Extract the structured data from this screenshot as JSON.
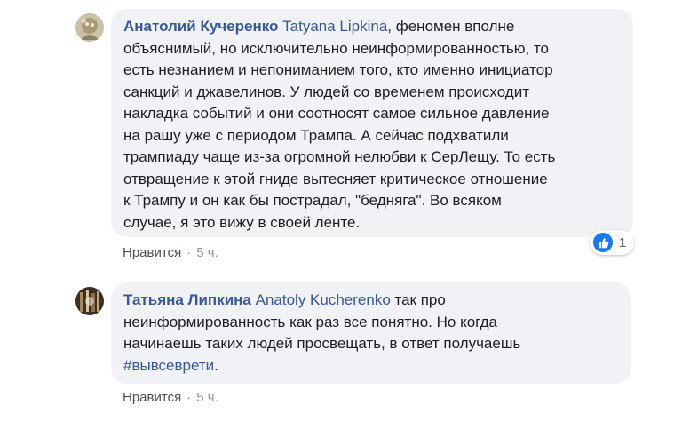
{
  "comments": [
    {
      "author": "Анатолий Кучеренко",
      "mention": "Tatyana Lipkina",
      "lines": [
        ", феномен вполне",
        "объяснимый, но исключительно неинформированностью, то",
        "есть незнанием и непониманием того, кто именно инициатор",
        "санкций и джавелинов. У людей со временем происходит",
        "накладка событий и они соотносят самое сильное давление",
        "на рашу уже с периодом Трампа. А сейчас подхватили",
        "трампиаду чаще из-за огромной нелюбви к СерЛещу. То есть",
        "отвращение к этой гниде вытесняет критическое отношение",
        "к Трампу и он как бы пострадал, \"бедняга\". Во всяком",
        "случае, я это вижу в своей ленте."
      ],
      "like_label": "Нравится",
      "time": "5 ч.",
      "reaction_count": "1",
      "reaction_icon": "thumbs-up-icon"
    },
    {
      "author": "Татьяна Липкина",
      "mention": "Anatoly Kucherenko",
      "lines": [
        " так про",
        "неинформированность как раз все понятно. Но когда",
        "начинаешь таких людей просвещать, в ответ получаешь"
      ],
      "hashtag": "#вывсеврети",
      "hashtag_suffix": ".",
      "like_label": "Нравится",
      "time": "5 ч."
    }
  ],
  "colors": {
    "link": "#385898",
    "bubble": "#f0f2f5",
    "meta": "#90949c",
    "like_badge": "#1877f2"
  }
}
